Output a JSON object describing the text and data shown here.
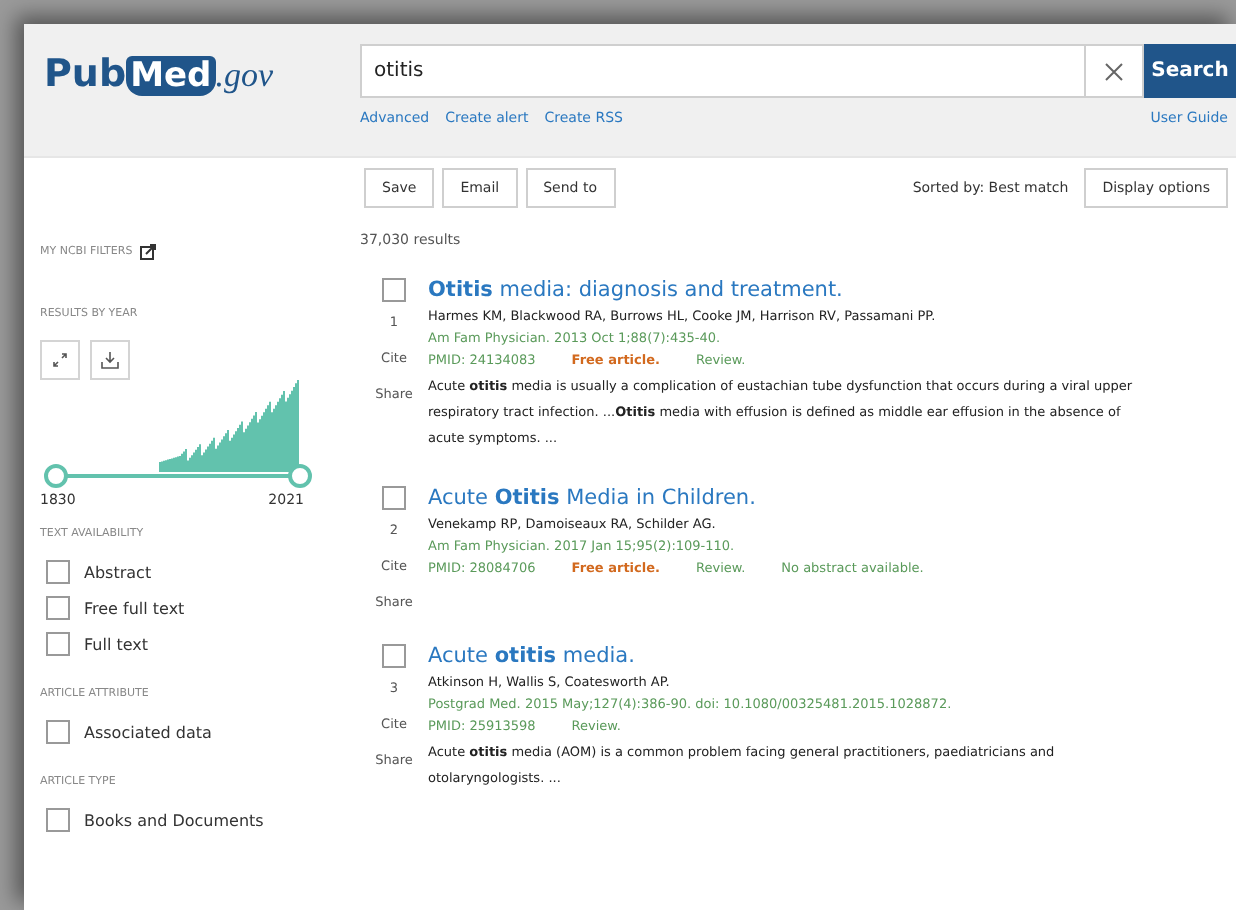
{
  "logo": {
    "text": "Pub",
    "text2": "Med",
    ".gov": ".gov"
  },
  "search": {
    "value": "otitis",
    "button": "Search",
    "links": [
      "Advanced",
      "Create alert",
      "Create RSS"
    ],
    "guide": "User Guide"
  },
  "toolbar": {
    "buttons": [
      "Save",
      "Email",
      "Send to"
    ],
    "sort": "Sorted by: Best match",
    "display": "Display options"
  },
  "sidebar": {
    "my_filters": "MY NCBI FILTERS",
    "by_year": "RESULTS BY YEAR",
    "year_from": "1830",
    "year_to": "2021",
    "groups": [
      {
        "heading": "TEXT AVAILABILITY",
        "items": [
          {
            "label": "Abstract",
            "checked": false
          },
          {
            "label": "Free full text",
            "checked": false
          },
          {
            "label": "Full text",
            "checked": false
          }
        ]
      },
      {
        "heading": "ARTICLE ATTRIBUTE",
        "items": [
          {
            "label": "Associated data",
            "checked": false
          }
        ]
      },
      {
        "heading": "ARTICLE TYPE",
        "items": [
          {
            "label": "Books and Documents",
            "checked": false
          }
        ]
      }
    ]
  },
  "results_count": "37,030 results",
  "results": [
    {
      "number": "1",
      "checked": false,
      "title": "**Otitis** media: diagnosis and treatment.",
      "authors": "Harmes KM, Blackwood RA, Burrows HL, Cooke JM, Harrison RV, Passamani PP.",
      "citation": "Am Fam Physician. 2013 Oct 1;88(7):435-40.",
      "tags": [
        {
          "kind": "pmid",
          "text": "PMID: 24134083"
        },
        {
          "kind": "free",
          "text": "Free article."
        },
        {
          "kind": "note",
          "text": "Review."
        }
      ],
      "snippet": "Acute **otitis** media is usually a complication of eustachian tube dysfunction that occurs during a viral upper respiratory tract infection. ...**Otitis** media with effusion is defined as middle ear effusion in the absence of acute symptoms. ...",
      "actions": [
        "Cite",
        "Share"
      ]
    },
    {
      "number": "2",
      "checked": false,
      "title": "Acute **Otitis** Media in Children.",
      "authors": "Venekamp RP, Damoiseaux RA, Schilder AG.",
      "citation": "Am Fam Physician. 2017 Jan 15;95(2):109-110.",
      "tags": [
        {
          "kind": "pmid",
          "text": "PMID: 28084706"
        },
        {
          "kind": "free",
          "text": "Free article."
        },
        {
          "kind": "note",
          "text": "Review."
        },
        {
          "kind": "note",
          "text": "No abstract available."
        }
      ],
      "actions": [
        "Cite",
        "Share"
      ]
    },
    {
      "number": "3",
      "checked": false,
      "title": "Acute **otitis** media.",
      "authors": "Atkinson H, Wallis S, Coatesworth AP.",
      "citation": "Postgrad Med. 2015 May;127(4):386-90. doi: 10.1080/00325481.2015.1028872.",
      "tags": [
        {
          "kind": "pmid",
          "text": "PMID: 25913598"
        },
        {
          "kind": "note",
          "text": "Review."
        }
      ],
      "snippet": "Acute **otitis** media (AOM) is a common problem facing general practitioners, paediatricians and otolaryngologists. ...",
      "actions": [
        "Cite",
        "Share"
      ]
    }
  ]
}
